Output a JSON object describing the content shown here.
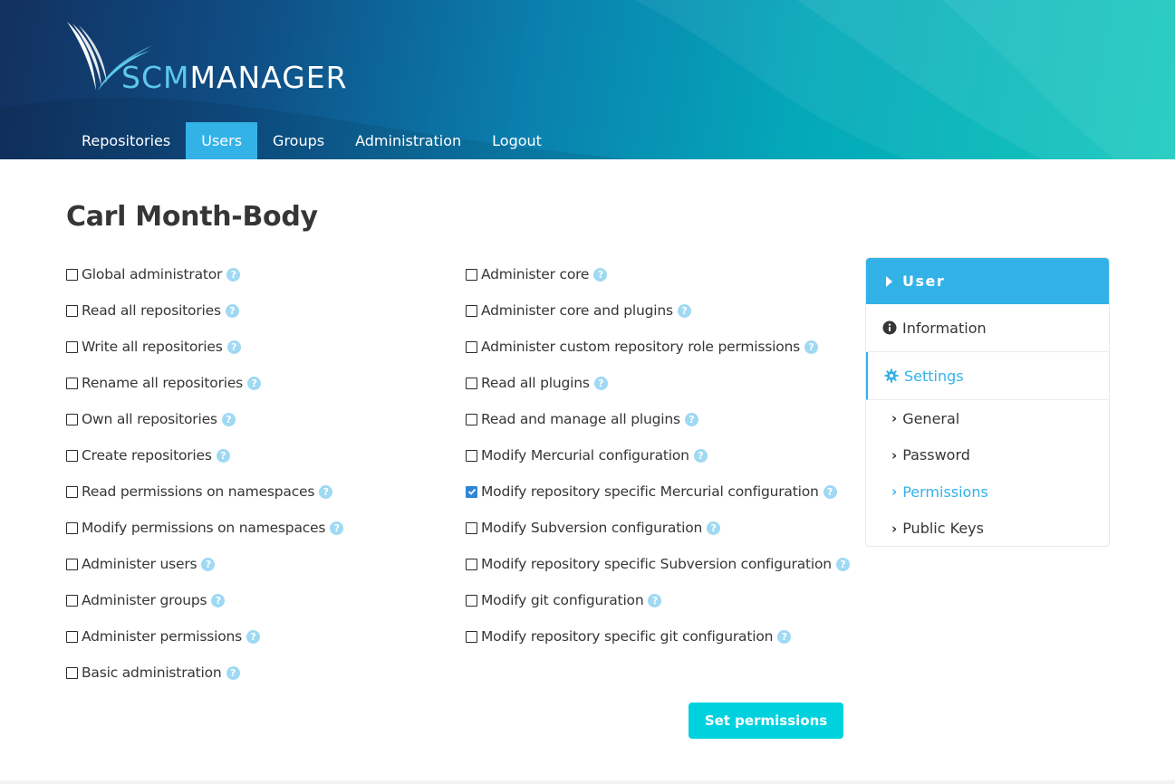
{
  "app": {
    "logo_prefix": "SCM",
    "logo_suffix": "MANAGER"
  },
  "nav": {
    "items": [
      {
        "label": "Repositories",
        "active": false
      },
      {
        "label": "Users",
        "active": true
      },
      {
        "label": "Groups",
        "active": false
      },
      {
        "label": "Administration",
        "active": false
      },
      {
        "label": "Logout",
        "active": false
      }
    ]
  },
  "page": {
    "title": "Carl Month-Body"
  },
  "permissions": {
    "left": [
      {
        "label": "Global administrator",
        "checked": false
      },
      {
        "label": "Read all repositories",
        "checked": false
      },
      {
        "label": "Write all repositories",
        "checked": false
      },
      {
        "label": "Rename all repositories",
        "checked": false
      },
      {
        "label": "Own all repositories",
        "checked": false
      },
      {
        "label": "Create repositories",
        "checked": false
      },
      {
        "label": "Read permissions on namespaces",
        "checked": false
      },
      {
        "label": "Modify permissions on namespaces",
        "checked": false
      },
      {
        "label": "Administer users",
        "checked": false
      },
      {
        "label": "Administer groups",
        "checked": false
      },
      {
        "label": "Administer permissions",
        "checked": false
      },
      {
        "label": "Basic administration",
        "checked": false
      }
    ],
    "right": [
      {
        "label": "Administer core",
        "checked": false
      },
      {
        "label": "Administer core and plugins",
        "checked": false
      },
      {
        "label": "Administer custom repository role permissions",
        "checked": false
      },
      {
        "label": "Read all plugins",
        "checked": false
      },
      {
        "label": "Read and manage all plugins",
        "checked": false
      },
      {
        "label": "Modify Mercurial configuration",
        "checked": false
      },
      {
        "label": "Modify repository specific Mercurial configuration",
        "checked": true
      },
      {
        "label": "Modify Subversion configuration",
        "checked": false
      },
      {
        "label": "Modify repository specific Subversion configuration",
        "checked": false
      },
      {
        "label": "Modify git configuration",
        "checked": false
      },
      {
        "label": "Modify repository specific git configuration",
        "checked": false
      }
    ],
    "submit_label": "Set permissions"
  },
  "sidebar": {
    "header": "User",
    "items": [
      {
        "label": "Information",
        "icon": "info-circle-icon",
        "active": false
      },
      {
        "label": "Settings",
        "icon": "gear-icon",
        "active": true
      }
    ],
    "sub_items": [
      {
        "label": "General",
        "active": false
      },
      {
        "label": "Password",
        "active": false
      },
      {
        "label": "Permissions",
        "active": true
      },
      {
        "label": "Public Keys",
        "active": false
      }
    ]
  },
  "colors": {
    "accent": "#33b2e8",
    "button": "#00d1df",
    "checkbox_checked": "#2f86d6",
    "help_icon": "#9fd9f3"
  }
}
